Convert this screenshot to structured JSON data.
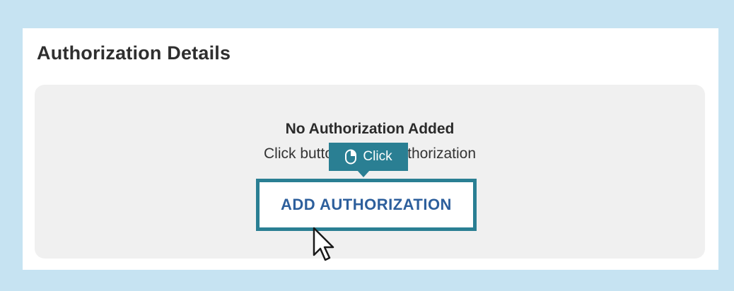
{
  "section": {
    "title": "Authorization Details"
  },
  "empty_state": {
    "title": "No Authorization Added",
    "subtitle": "Click button to add authorization",
    "button_label": "ADD AUTHORIZATION"
  },
  "tooltip": {
    "label": "Click",
    "icon": "mouse-icon"
  },
  "colors": {
    "background": "#c6e3f2",
    "accent": "#2a7f93",
    "button_text": "#2d5f9c",
    "panel": "#f0f0f0"
  }
}
